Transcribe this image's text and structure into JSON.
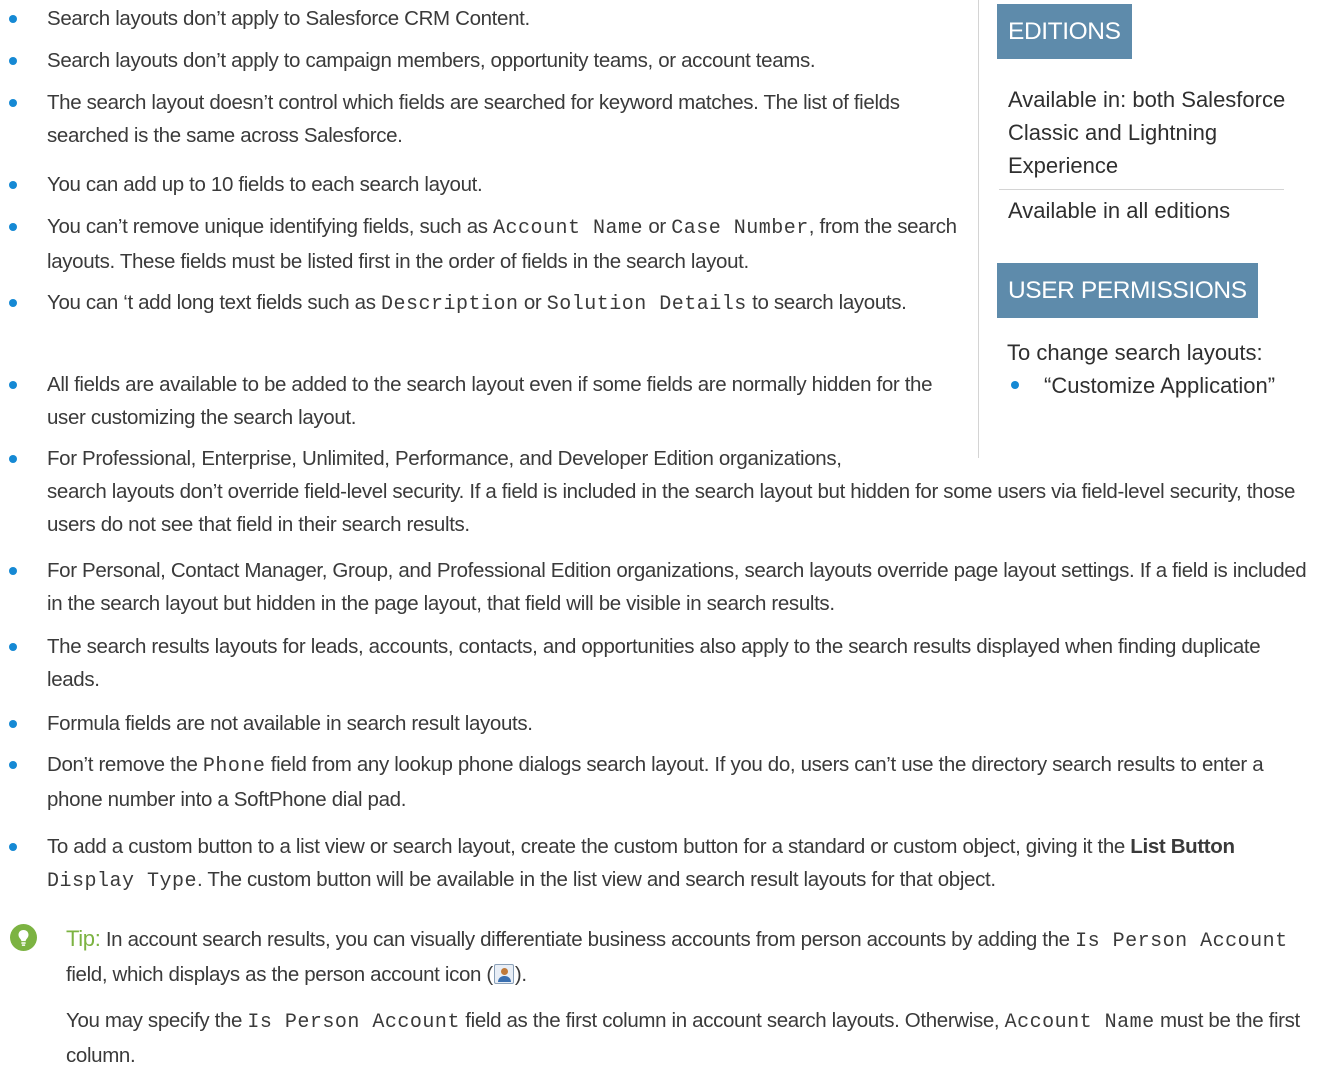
{
  "bullets": [
    {
      "parts": [
        {
          "t": "Search layouts don’t apply to Salesforce CRM Content."
        }
      ]
    },
    {
      "parts": [
        {
          "t": "Search layouts don’t apply to campaign members, opportunity teams, or account teams."
        }
      ]
    },
    {
      "parts": [
        {
          "t": "The search layout doesn’t control which fields are searched for keyword matches. The list of fields searched is the same across Salesforce."
        }
      ]
    },
    {
      "parts": [
        {
          "t": "You can add up to 10 fields to each search layout."
        }
      ]
    },
    {
      "parts": [
        {
          "t": "You can’t remove unique identifying fields, such as "
        },
        {
          "t": "Account Name",
          "s": "mono"
        },
        {
          "t": " or "
        },
        {
          "t": "Case Number",
          "s": "mono"
        },
        {
          "t": ", from the search layouts. These fields must be listed first in the order of fields in the search layout."
        }
      ]
    },
    {
      "parts": [
        {
          "t": "You can ‘t add long text fields such as "
        },
        {
          "t": "Description",
          "s": "mono"
        },
        {
          "t": " or "
        },
        {
          "t": "Solution Details",
          "s": "mono"
        },
        {
          "t": " to search layouts."
        }
      ]
    },
    {
      "parts": [
        {
          "t": "All fields are available to be added to the search layout even if some fields are normally hidden for the user customizing the search layout."
        }
      ]
    },
    {
      "parts": [
        {
          "t": "For Professional, Enterprise, Unlimited, Performance, and Developer Edition organizations,"
        },
        {
          "t": "",
          "s": "br"
        },
        {
          "t": "search layouts don’t override field-level security. If a field is included in the search layout but hidden for some users via field-level security, those users do not see that field in their search results."
        }
      ]
    },
    {
      "parts": [
        {
          "t": "For Personal, Contact Manager, Group, and Professional Edition organizations, search layouts override page layout settings. If a field is included in the search layout but hidden in the page layout, that field will be visible in search results."
        }
      ]
    },
    {
      "parts": [
        {
          "t": "The search results layouts for leads, accounts, contacts, and opportunities also apply to the search results displayed when finding duplicate leads."
        }
      ]
    },
    {
      "parts": [
        {
          "t": "Formula fields are not available in search result layouts."
        }
      ]
    },
    {
      "parts": [
        {
          "t": "Don’t remove the "
        },
        {
          "t": "Phone",
          "s": "mono"
        },
        {
          "t": " field from any lookup phone dialogs search layout. If you do, users can’t use the directory search results to enter a phone number into a SoftPhone dial pad."
        }
      ]
    },
    {
      "parts": [
        {
          "t": "To add a custom button to a list view or search layout, create the custom button for a standard or custom object, giving it the "
        },
        {
          "t": "List Button",
          "s": "b"
        },
        {
          "t": " "
        },
        {
          "t": "Display Type",
          "s": "mono"
        },
        {
          "t": ". The custom button will be available in the list view and search result layouts for that object."
        }
      ]
    }
  ],
  "sidebar": {
    "editions_header": "EDITIONS",
    "available_in": "Available in: both Salesforce Classic and Lightning Experience",
    "all_editions": "Available in all editions",
    "permissions_header": "USER PERMISSIONS",
    "permissions_label": "To change search layouts:",
    "permission_item": "“Customize Application”"
  },
  "tip": {
    "label": "Tip:",
    "para1": [
      {
        "t": "In account search results, you can visually differentiate business accounts from person accounts by adding the "
      },
      {
        "t": "Is Person Account",
        "s": "mono"
      },
      {
        "t": " field, which displays as the person account icon ("
      },
      {
        "t": "",
        "s": "icon"
      },
      {
        "t": ")."
      }
    ],
    "para2": [
      {
        "t": "You may specify the "
      },
      {
        "t": "Is Person Account",
        "s": "mono"
      },
      {
        "t": " field as the first column in account search layouts. Otherwise, "
      },
      {
        "t": "Account Name",
        "s": "mono"
      },
      {
        "t": " must be the first column."
      }
    ]
  },
  "colors": {
    "bullet": "#1589d4",
    "header_bg": "#5e8bab",
    "tip": "#7cb342"
  }
}
